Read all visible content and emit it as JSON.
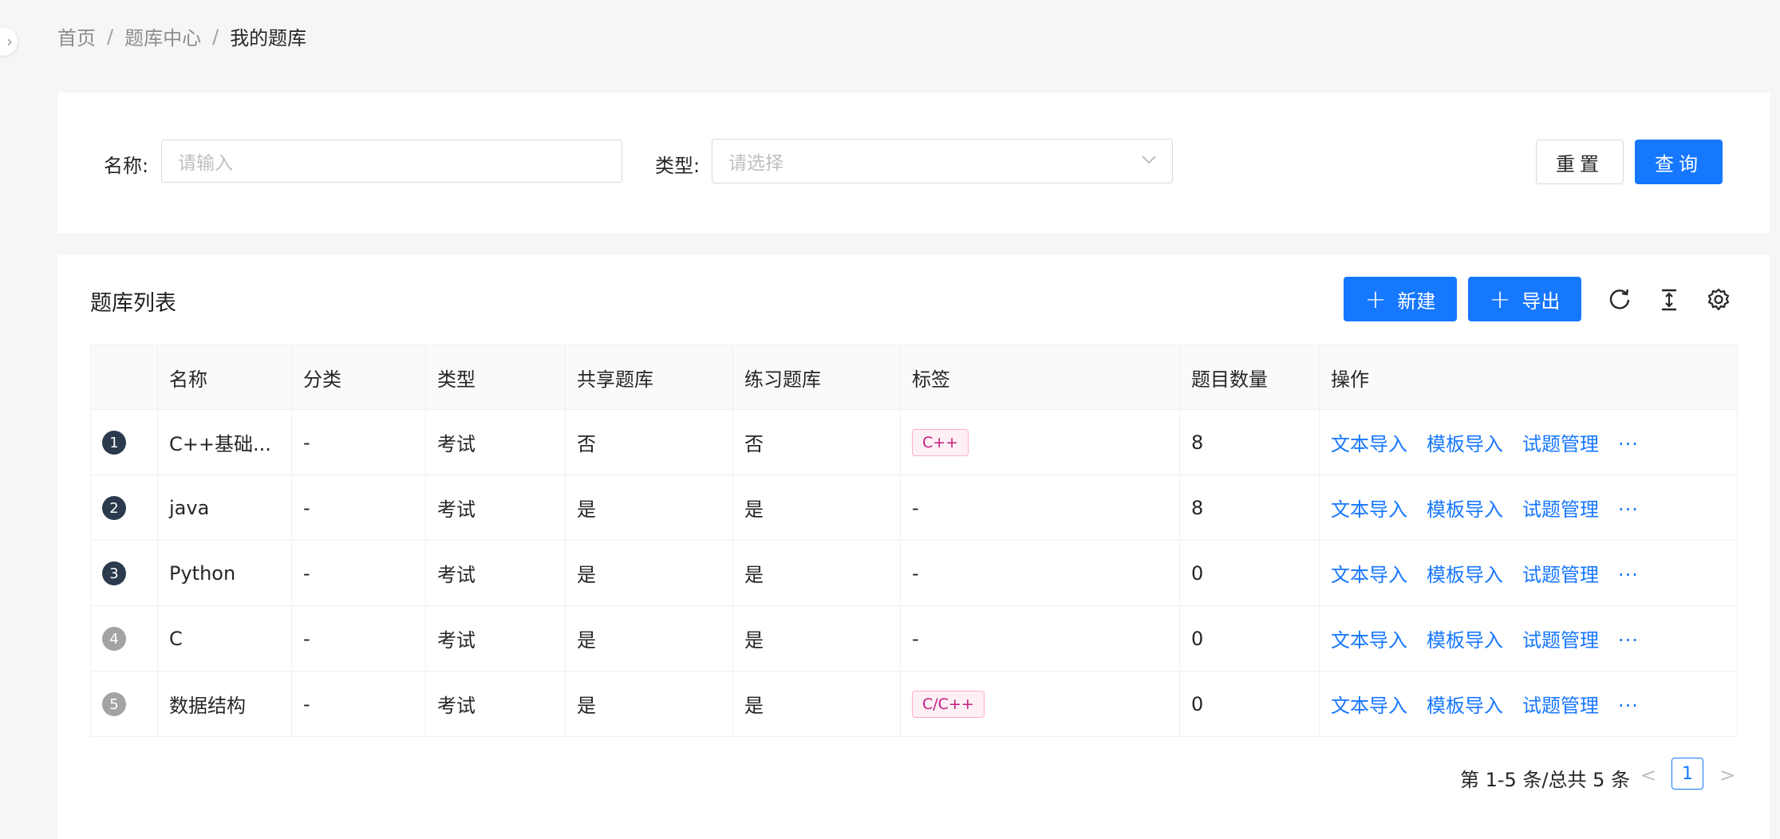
{
  "breadcrumb": {
    "home": "首页",
    "bank_center": "题库中心",
    "current": "我的题库",
    "separator": "/"
  },
  "filter": {
    "name_label": "名称:",
    "name_placeholder": "请输入",
    "type_label": "类型:",
    "type_placeholder": "请选择",
    "reset_label": "重置",
    "query_label": "查询"
  },
  "list": {
    "title": "题库列表",
    "new_label": "新建",
    "export_label": "导出",
    "toolbar_icons": [
      "reload-icon",
      "column-height-icon",
      "setting-icon"
    ],
    "columns": [
      "名称",
      "分类",
      "类型",
      "共享题库",
      "练习题库",
      "标签",
      "题目数量",
      "操作"
    ],
    "rows": [
      {
        "index": "1",
        "name": "C++基础...",
        "category": "-",
        "type": "考试",
        "shared": "否",
        "practice": "否",
        "tag": "C++",
        "count": "8"
      },
      {
        "index": "2",
        "name": "java",
        "category": "-",
        "type": "考试",
        "shared": "是",
        "practice": "是",
        "tag": "-",
        "count": "8"
      },
      {
        "index": "3",
        "name": "Python",
        "category": "-",
        "type": "考试",
        "shared": "是",
        "practice": "是",
        "tag": "-",
        "count": "0"
      },
      {
        "index": "4",
        "name": "C",
        "category": "-",
        "type": "考试",
        "shared": "是",
        "practice": "是",
        "tag": "-",
        "count": "0"
      },
      {
        "index": "5",
        "name": "数据结构",
        "category": "-",
        "type": "考试",
        "shared": "是",
        "practice": "是",
        "tag": "C/C++",
        "count": "0"
      }
    ],
    "actions": {
      "text_import": "文本导入",
      "template_import": "模板导入",
      "question_manage": "试题管理",
      "more": "···"
    }
  },
  "pagination": {
    "summary": "第 1-5 条/总共 5 条",
    "current_page": "1",
    "prev": "<",
    "next": ">"
  },
  "colors": {
    "primary": "#1677ff",
    "index_dark": "#2b3a4d",
    "index_light": "#a3a3a3",
    "tag_text": "#c41d7f"
  }
}
